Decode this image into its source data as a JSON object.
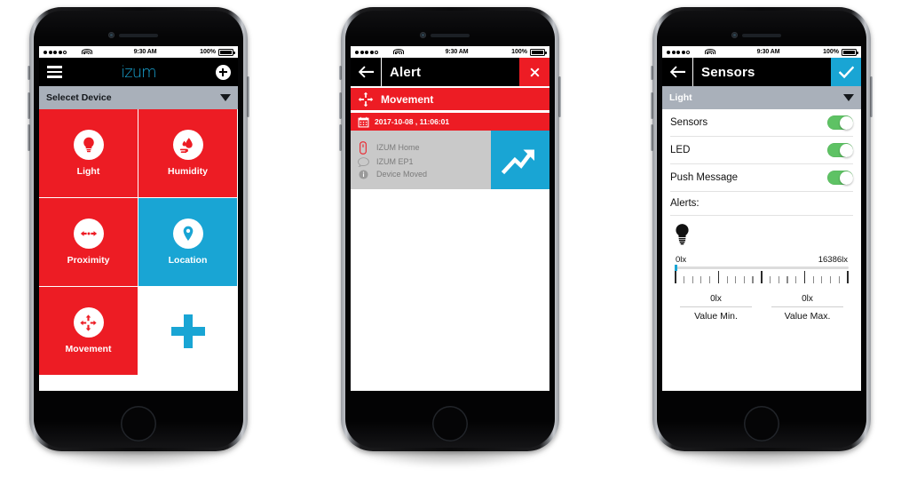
{
  "statusbar": {
    "time": "9:30 AM",
    "battery_pct": "100%",
    "signal_dots": 5,
    "signal_filled": 4,
    "wifi_icon": "wifi-icon",
    "battery_icon": "battery-full-icon"
  },
  "phone1": {
    "nav": {
      "menu_icon": "hamburger-menu-icon",
      "logo": "izum",
      "add_icon": "plus-circle-icon"
    },
    "select_bar": {
      "label": "Selecet Device",
      "caret_icon": "chevron-down-icon"
    },
    "tiles": [
      {
        "label": "Light",
        "color": "#ed1c24",
        "icon": "lightbulb-icon",
        "kind": "red"
      },
      {
        "label": "Humidity",
        "color": "#ed1c24",
        "icon": "humidity-icon",
        "kind": "red"
      },
      {
        "label": "Proximity",
        "color": "#ed1c24",
        "icon": "proximity-icon",
        "kind": "red"
      },
      {
        "label": "Location",
        "color": "#19a5d4",
        "icon": "location-pin-icon",
        "kind": "cyan"
      },
      {
        "label": "Movement",
        "color": "#ed1c24",
        "icon": "movement-icon",
        "kind": "red"
      },
      {
        "label": "",
        "color": "#ffffff",
        "icon": "plus-icon",
        "kind": "blank"
      }
    ]
  },
  "phone2": {
    "nav": {
      "back_icon": "arrow-left-icon",
      "title": "Alert",
      "close_icon": "close-x-icon",
      "close_color": "#ed1c24"
    },
    "category": {
      "icon": "movement-arrows-icon",
      "label": "Movement"
    },
    "date": {
      "icon": "calendar-icon",
      "label": "2017-10-08 , 11:06:01"
    },
    "card": {
      "rows": [
        {
          "icon": "device-icon",
          "text": "IZUM  Home"
        },
        {
          "icon": "comment-icon",
          "text": "IZUM  EP1"
        },
        {
          "icon": "info-icon",
          "text": "Device Moved"
        }
      ],
      "chart_icon": "trending-up-icon",
      "chart_color": "#19a5d4"
    }
  },
  "phone3": {
    "nav": {
      "back_icon": "arrow-left-icon",
      "title": "Sensors",
      "confirm_icon": "check-icon",
      "confirm_color": "#19a5d4"
    },
    "select_bar": {
      "label": "Light",
      "caret_icon": "chevron-down-icon"
    },
    "toggles": [
      {
        "label": "Sensors",
        "state": "on",
        "color": "#5ec264"
      },
      {
        "label": "LED",
        "state": "on",
        "color": "#5ec264"
      },
      {
        "label": "Push Message",
        "state": "on",
        "color": "#5ec264"
      }
    ],
    "alerts_label": "Alerts:",
    "bulb_icon": "lightbulb-filled-icon",
    "slider": {
      "min_label": "0lx",
      "max_label": "16386lx",
      "handle_position_pct": 0,
      "major_ticks": 5,
      "minor_per_major": 4
    },
    "values": [
      {
        "value": "0lx",
        "label": "Value Min."
      },
      {
        "value": "0lx",
        "label": "Value Max."
      }
    ]
  }
}
